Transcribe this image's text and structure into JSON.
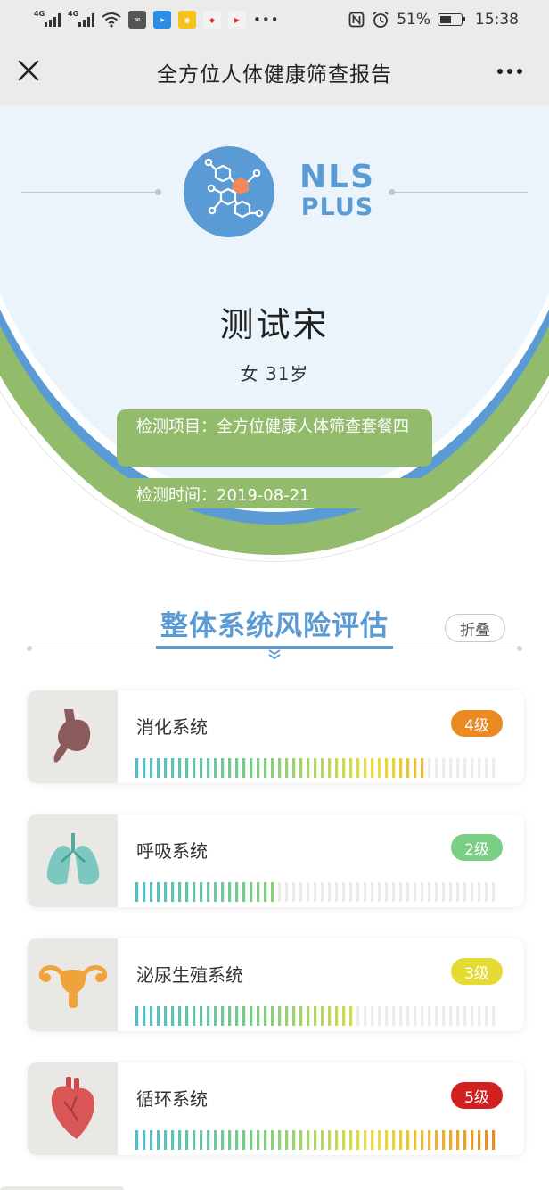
{
  "status_bar": {
    "sig1_label": "4G",
    "sig2_label": "4G",
    "battery": "51%",
    "time": "15:38"
  },
  "nav": {
    "title": "全方位人体健康筛查报告"
  },
  "logo": {
    "line1": "NLS",
    "line2": "PLUS"
  },
  "person": {
    "name": "测试宋",
    "gender_age": "女  31岁"
  },
  "info": {
    "project": "检测项目：全方位健康人体筛查套餐四",
    "date": "检测时间：2019-08-21"
  },
  "section": {
    "title": "整体系统风险评估",
    "collapse_label": "折叠"
  },
  "colors": {
    "blue": "#5b9bd5",
    "green": "#93bb6c",
    "level2": "#7bcf85",
    "level3": "#e4dc33",
    "level4": "#ec8a22",
    "level5": "#d12020"
  },
  "systems": [
    {
      "name": "消化系统",
      "level": "4级",
      "level_value": 4,
      "fill_fraction": 0.8,
      "icon": "stomach-icon",
      "badge_color": "#ec8a22"
    },
    {
      "name": "呼吸系统",
      "level": "2级",
      "level_value": 2,
      "fill_fraction": 0.4,
      "icon": "lungs-icon",
      "badge_color": "#7bcf85"
    },
    {
      "name": "泌尿生殖系统",
      "level": "3级",
      "level_value": 3,
      "fill_fraction": 0.6,
      "icon": "uterus-icon",
      "badge_color": "#e4dc33"
    },
    {
      "name": "循环系统",
      "level": "5级",
      "level_value": 5,
      "fill_fraction": 1.0,
      "icon": "heart-icon",
      "badge_color": "#d12020"
    }
  ]
}
